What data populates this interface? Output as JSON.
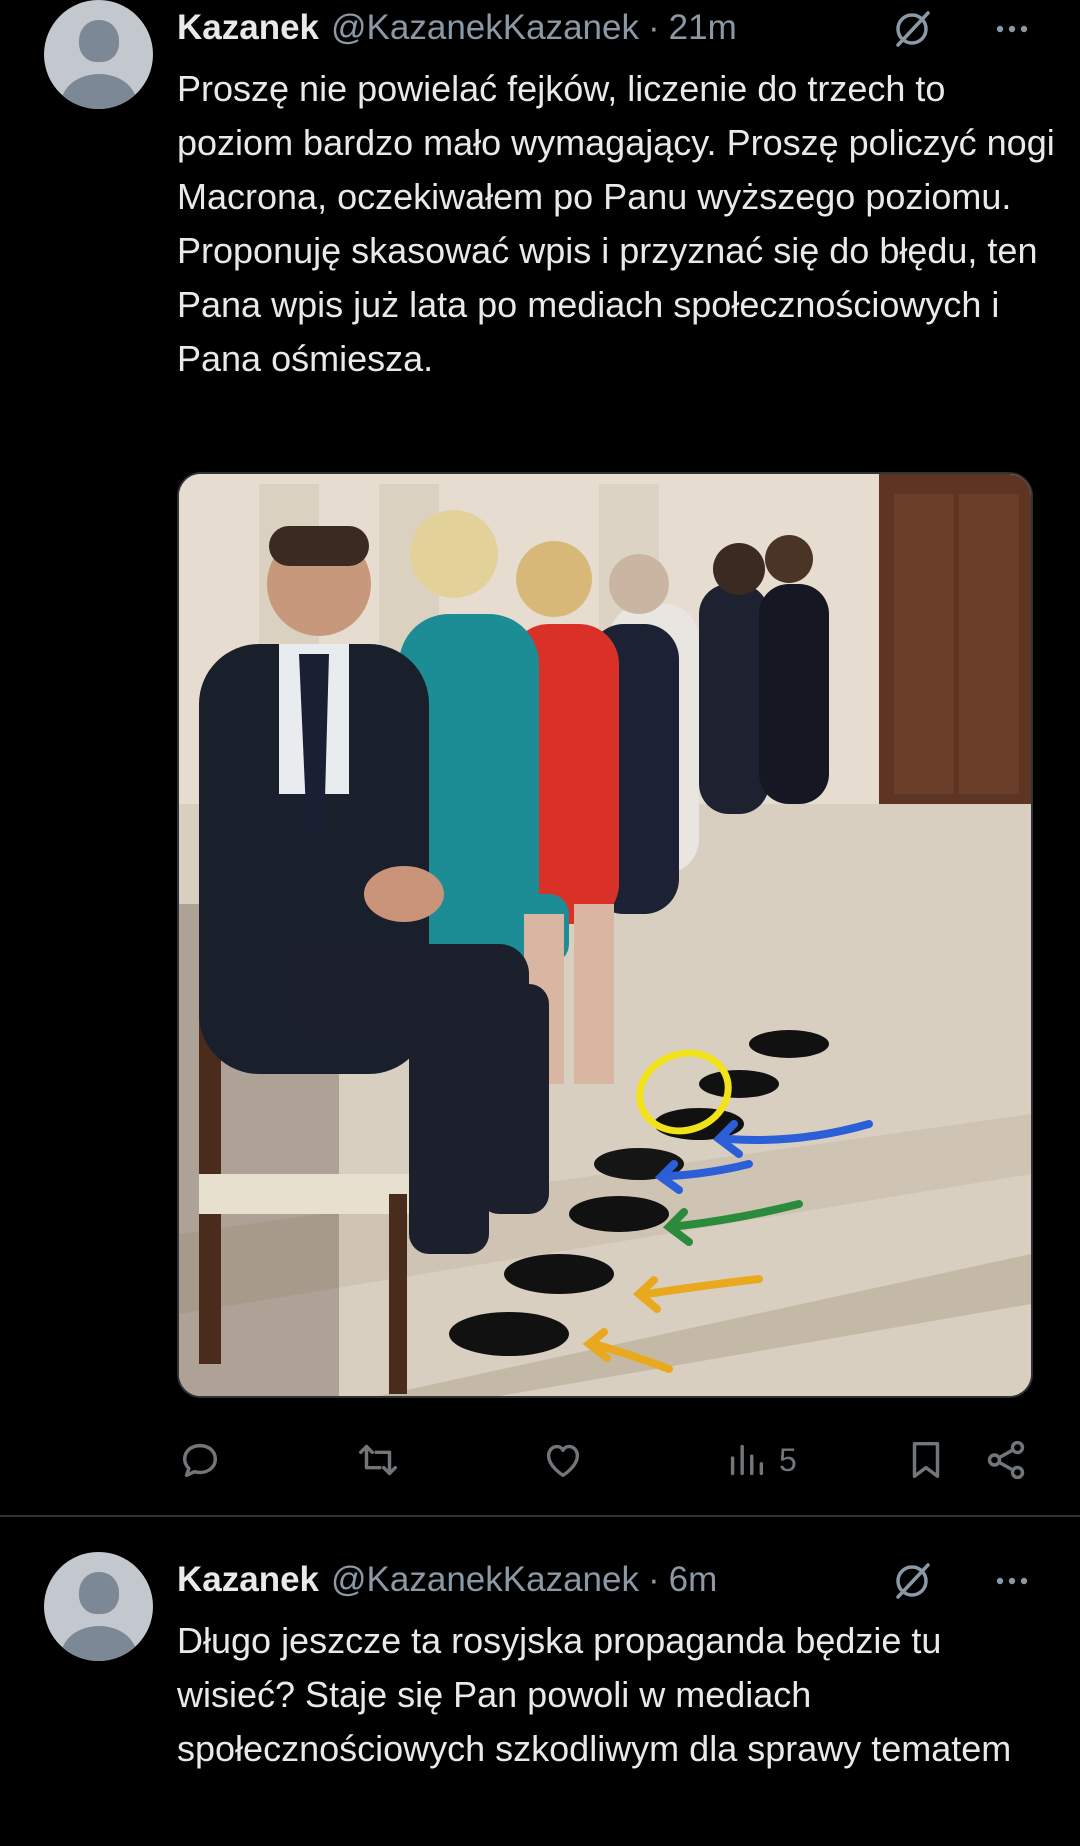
{
  "tweets": [
    {
      "author": {
        "name": "Kazanek",
        "handle": "@KazanekKazanek",
        "separator": "·",
        "time": "21m"
      },
      "text": "Proszę nie powielać fejków, liczenie do trzech to poziom bardzo mało wymagający. Proszę policzyć nogi Macrona, oczekiwałem po Panu wyższego poziomu. Proponuję skasować wpis i przyznać się do błędu, ten Pana wpis już lata po mediach społecznościowych i Pana ośmiesza.",
      "actions": {
        "views_count": "5"
      }
    },
    {
      "author": {
        "name": "Kazanek",
        "handle": "@KazanekKazanek",
        "separator": "·",
        "time": "6m"
      },
      "text": "Długo jeszcze ta rosyjska propaganda będzie tu wisieć? Staje się Pan powoli w mediach społecznościowych szkodliwym dla sprawy tematem"
    }
  ],
  "icons": {
    "reply": "reply-icon",
    "retweet": "retweet-icon",
    "like": "heart-icon",
    "views": "views-icon",
    "bookmark": "bookmark-icon",
    "share": "share-icon",
    "grok": "grok-icon",
    "more": "more-icon"
  },
  "colors": {
    "background": "#000000",
    "text": "#e7e9ea",
    "muted": "#71767b",
    "divider": "#2f3336"
  }
}
